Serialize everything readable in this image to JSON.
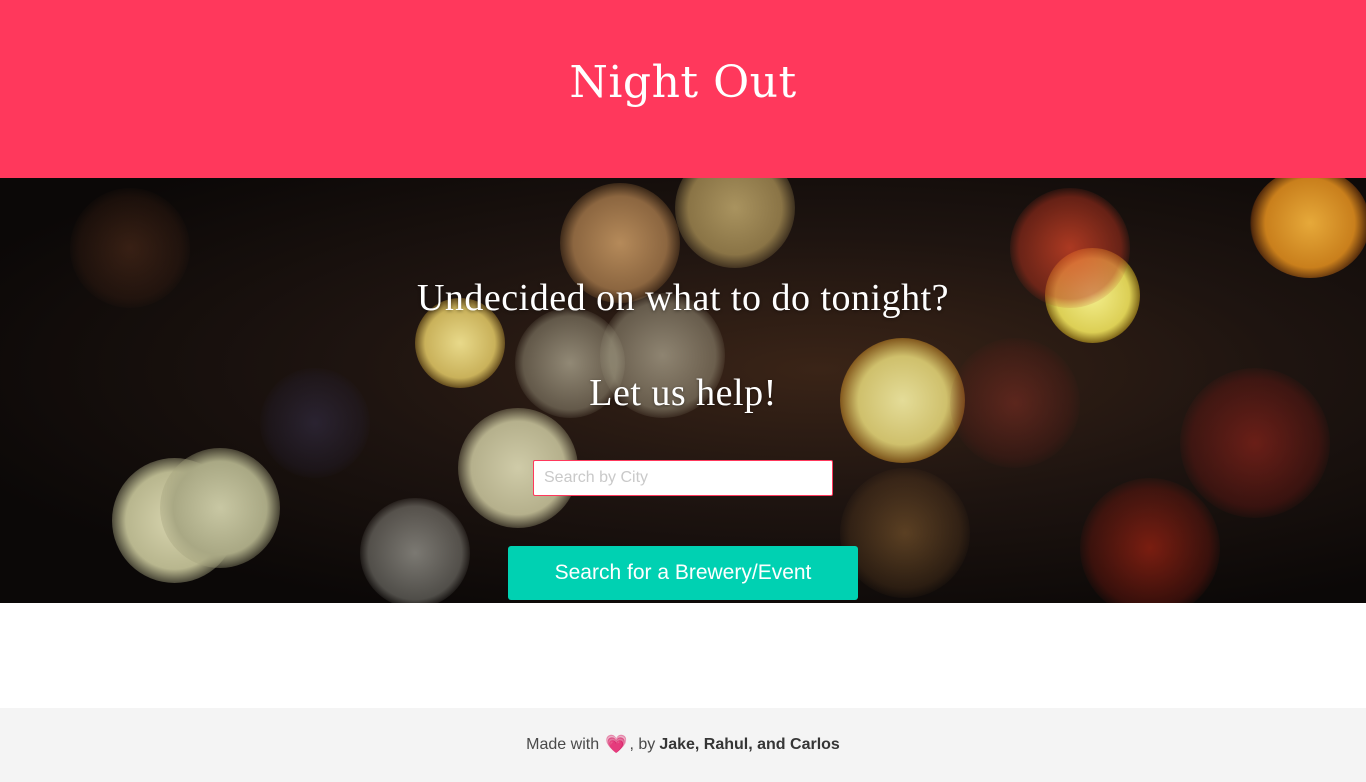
{
  "header": {
    "title": "Night Out",
    "background_color": "#ff385c"
  },
  "hero": {
    "question": "Undecided on what to do tonight?",
    "help_text": "Let us help!",
    "search": {
      "placeholder": "Search by City",
      "value": ""
    },
    "search_button_label": "Search for a Brewery/Event",
    "button_color": "#00d1b2"
  },
  "footer": {
    "made_with": "Made with",
    "heart_icon": "heart-icon",
    "heart_glyph": "💗",
    "by": ", by",
    "authors": "Jake, Rahul, and Carlos",
    "background_color": "#f4f4f4"
  }
}
